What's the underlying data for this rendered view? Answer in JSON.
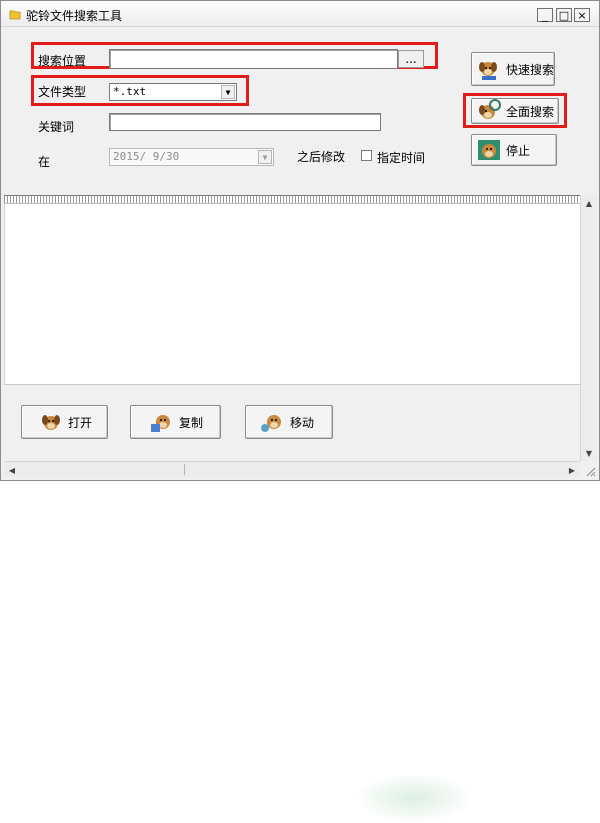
{
  "window": {
    "title": "驼铃文件搜索工具",
    "min_label": "_",
    "max_label": "□",
    "close_label": "×"
  },
  "form": {
    "search_location_label": "搜索位置",
    "search_location_value": "",
    "browse_label": "...",
    "file_type_label": "文件类型",
    "file_type_value": "*.txt",
    "keyword_label": "关键词",
    "keyword_value": "",
    "at_label": "在",
    "date_value": "2015/ 9/30",
    "after_modified_label": "之后修改",
    "specify_time_label": "指定时间",
    "specify_time_checked": false
  },
  "actions": {
    "quick_search": "快速搜索",
    "full_search": "全面搜索",
    "stop": "停止"
  },
  "bottom_buttons": {
    "open": "打开",
    "copy": "复制",
    "move": "移动"
  },
  "icons": {
    "app": "folder-icon",
    "dog": "dog-icon"
  },
  "colors": {
    "highlight": "#e21b1b"
  }
}
